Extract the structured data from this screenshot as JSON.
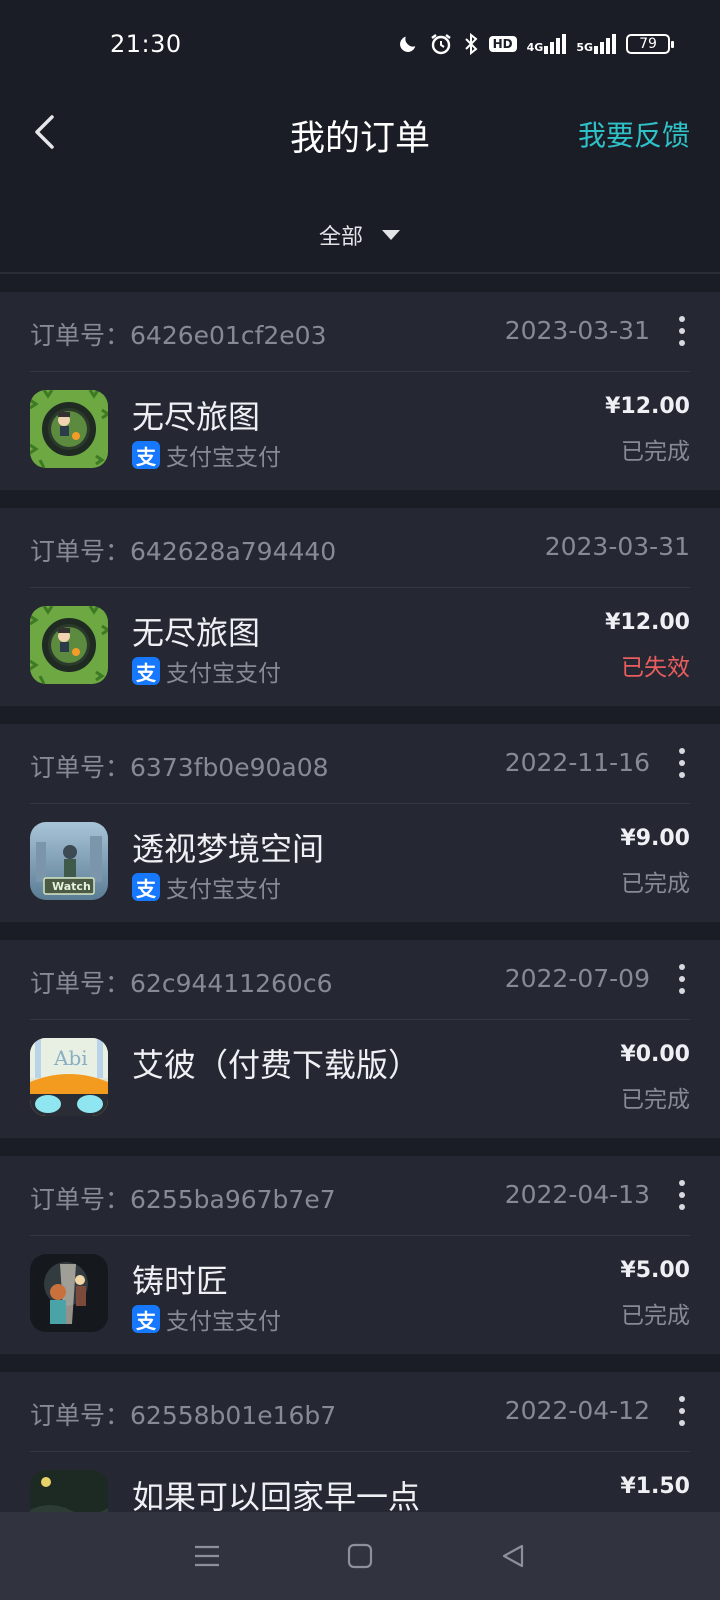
{
  "status_bar": {
    "time": "21:30",
    "icons": [
      "moon-icon",
      "alarm-icon",
      "bluetooth-icon",
      "hd-icon",
      "4g-signal-icon",
      "5g-signal-icon",
      "battery-icon"
    ],
    "hd_label": "HD",
    "net_4g": "4G",
    "net_5g": "5G",
    "battery_level": "79"
  },
  "header": {
    "title": "我的订单",
    "feedback": "我要反馈"
  },
  "filter": {
    "label": "全部"
  },
  "orders": [
    {
      "order_no_label": "订单号：",
      "order_no": "6426e01cf2e03",
      "date": "2023-03-31",
      "app_name": "无尽旅图",
      "pay_method": "支付宝支付",
      "price": "¥12.00",
      "status": "已完成"
    },
    {
      "order_no_label": "订单号：",
      "order_no": "642628a794440",
      "date": "2023-03-31",
      "app_name": "无尽旅图",
      "pay_method": "支付宝支付",
      "price": "¥12.00",
      "status": "已失效"
    },
    {
      "order_no_label": "订单号：",
      "order_no": "6373fb0e90a08",
      "date": "2022-11-16",
      "app_name": "透视梦境空间",
      "pay_method": "支付宝支付",
      "price": "¥9.00",
      "status": "已完成",
      "icon_text": "Watch"
    },
    {
      "order_no_label": "订单号：",
      "order_no": "62c94411260c6",
      "date": "2022-07-09",
      "app_name": "艾彼（付费下载版）",
      "price": "¥0.00",
      "status": "已完成",
      "icon_text": "Abi"
    },
    {
      "order_no_label": "订单号：",
      "order_no": "6255ba967b7e7",
      "date": "2022-04-13",
      "app_name": "铸时匠",
      "pay_method": "支付宝支付",
      "price": "¥5.00",
      "status": "已完成"
    },
    {
      "order_no_label": "订单号：",
      "order_no": "62558b01e16b7",
      "date": "2022-04-12",
      "app_name": "如果可以回家早一点",
      "price": "¥1.50"
    }
  ],
  "alipay_glyph": "支",
  "colors": {
    "accent": "#2fc1c8",
    "invalid": "#e85d5d",
    "alipay": "#1677ff"
  },
  "bottom_nav": [
    "menu-icon",
    "home-icon",
    "back-icon"
  ]
}
